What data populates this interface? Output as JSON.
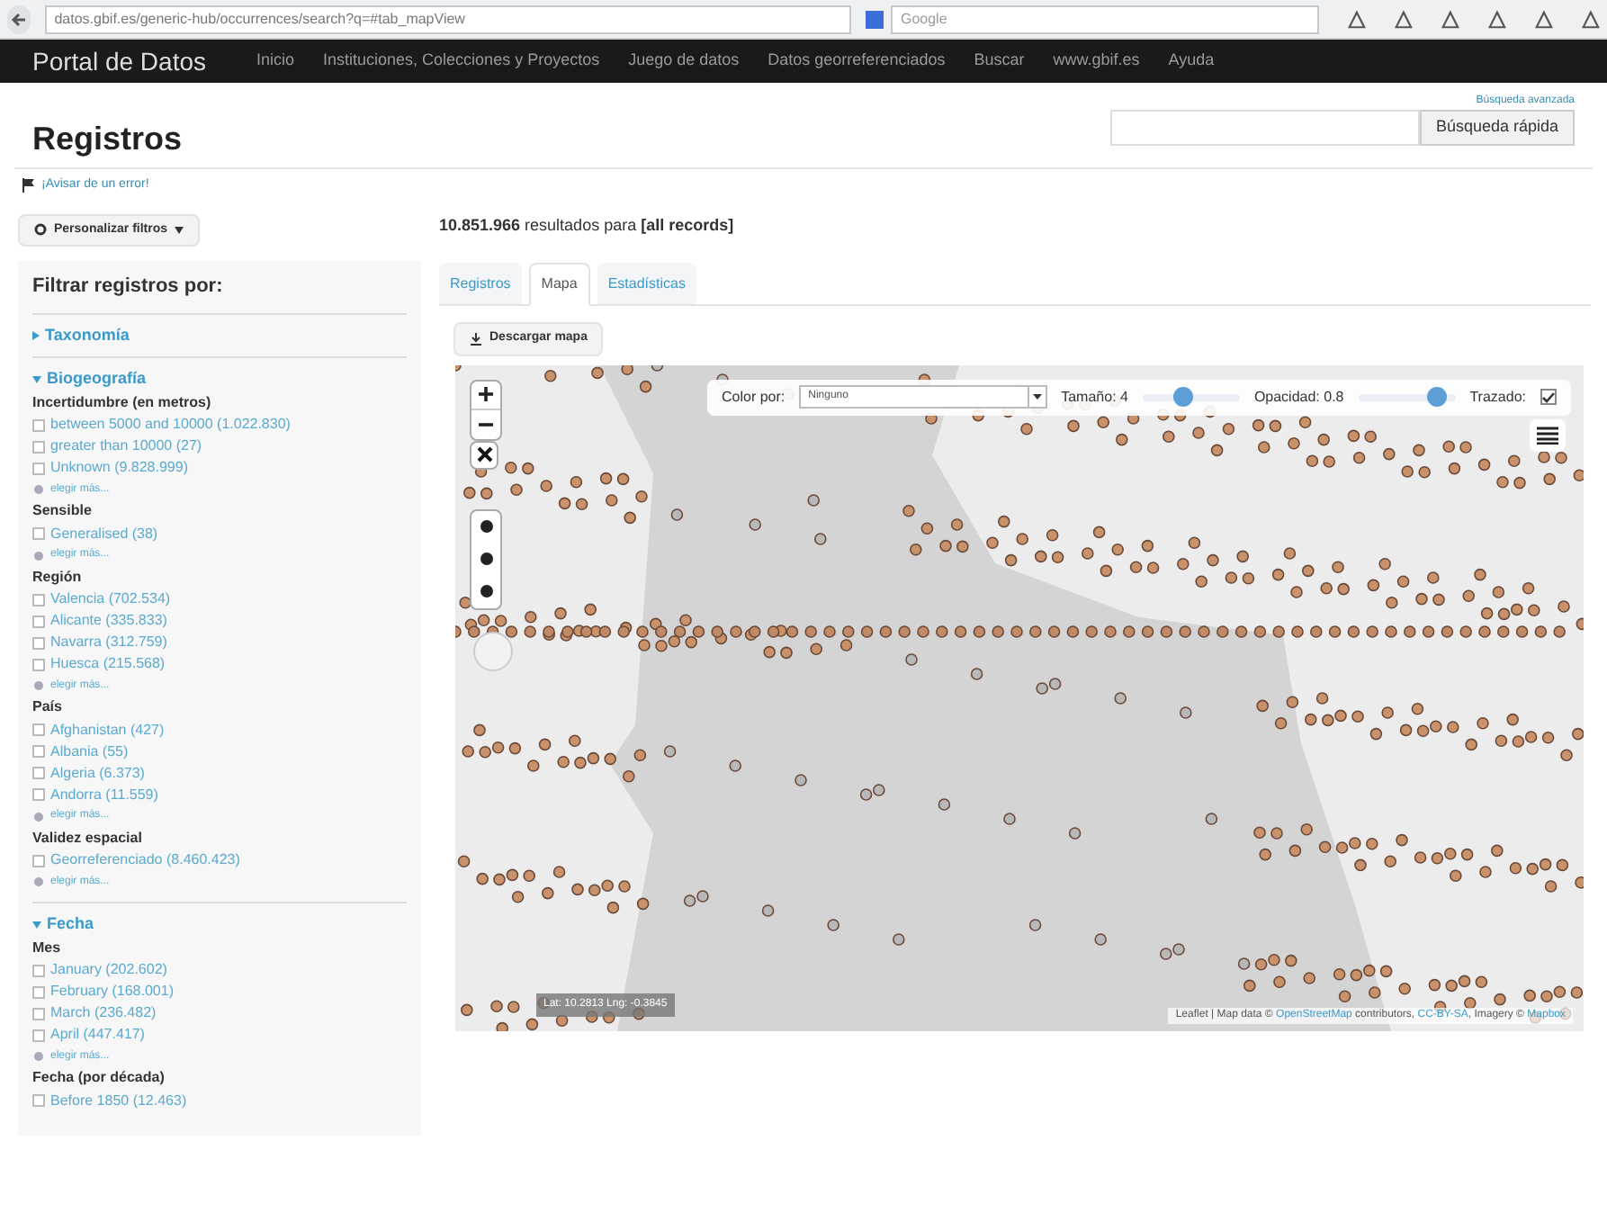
{
  "browser": {
    "url": "datos.gbif.es/generic-hub/occurrences/search?q=#tab_mapView",
    "search_placeholder": "Google"
  },
  "nav": {
    "brand": "Portal de Datos",
    "items": [
      "Inicio",
      "Instituciones, Colecciones y Proyectos",
      "Juego de datos",
      "Datos georreferenciados",
      "Buscar",
      "www.gbif.es",
      "Ayuda"
    ]
  },
  "header": {
    "title": "Registros",
    "advanced_link": "Búsqueda avanzada",
    "search_button": "Búsqueda rápida",
    "report_link": "¡Avisar de un error!"
  },
  "sidebar": {
    "customize_button": "Personalizar filtros",
    "heading": "Filtrar registros por:",
    "sections": [
      {
        "title": "Taxonomía",
        "expanded": false
      },
      {
        "title": "Biogeografía",
        "expanded": true,
        "groups": [
          {
            "title": "Incertidumbre (en metros)",
            "items": [
              {
                "label": "between 5000 and 10000 (1.022.830)",
                "checked": false
              },
              {
                "label": "greater than 10000 (27)",
                "checked": false
              },
              {
                "label": "Unknown (9.828.999)",
                "checked": false
              }
            ],
            "more": "elegir más..."
          },
          {
            "title": "Sensible",
            "items": [
              {
                "label": "Generalised (38)",
                "checked": false
              }
            ],
            "more": "elegir más..."
          },
          {
            "title": "Región",
            "items": [
              {
                "label": "Valencia (702.534)",
                "checked": false
              },
              {
                "label": "Alicante (335.833)",
                "checked": false
              },
              {
                "label": "Navarra (312.759)",
                "checked": false
              },
              {
                "label": "Huesca (215.568)",
                "checked": false
              }
            ],
            "more": "elegir más..."
          },
          {
            "title": "País",
            "items": [
              {
                "label": "Afghanistan (427)",
                "checked": false
              },
              {
                "label": "Albania (55)",
                "checked": false
              },
              {
                "label": "Algeria (6.373)",
                "checked": false
              },
              {
                "label": "Andorra (11.559)",
                "checked": false
              }
            ],
            "more": "elegir más..."
          },
          {
            "title": "Validez espacial",
            "items": [
              {
                "label": "Georreferenciado (8.460.423)",
                "checked": false
              }
            ],
            "more": "elegir más..."
          }
        ]
      },
      {
        "title": "Fecha",
        "expanded": true,
        "groups": [
          {
            "title": "Mes",
            "items": [
              {
                "label": "January (202.602)",
                "checked": false
              },
              {
                "label": "February (168.001)",
                "checked": false
              },
              {
                "label": "March (236.482)",
                "checked": false
              },
              {
                "label": "April (447.417)",
                "checked": false
              }
            ],
            "more": "elegir más..."
          },
          {
            "title": "Fecha (por década)",
            "items": [
              {
                "label": "Before 1850 (12.463)",
                "checked": false
              }
            ]
          }
        ]
      }
    ]
  },
  "results": {
    "summary": "**10.851.966** resultados para **[all records]**"
  },
  "tabs": [
    {
      "label": "Registros",
      "selected": false
    },
    {
      "label": "Mapa",
      "selected": true
    },
    {
      "label": "Estadísticas",
      "selected": false
    }
  ],
  "download_button": "Descargar mapa",
  "map_options": {
    "color_label": "Color por:",
    "color_value": "Ninguno",
    "size_label": "Tamaño: 4",
    "size_slider": {
      "level": 0.4
    },
    "opacity_label": "Opacidad: 0.8",
    "opacity_slider": {
      "level": 0.8
    },
    "trace_label": "Trazado:",
    "trace_checked": true
  },
  "map": {
    "coordinates": "Lat: 10.2813 Lng: -0.3845",
    "attribution_prefix": "Leaflet | Map data © ",
    "attribution_osm": "OpenStreetMap",
    "attribution_middle": " contributors, ",
    "attribution_license": "CC-BY-SA",
    "attribution_imagery": ", Imagery © ",
    "attribution_mapbox": "Mapbox"
  }
}
